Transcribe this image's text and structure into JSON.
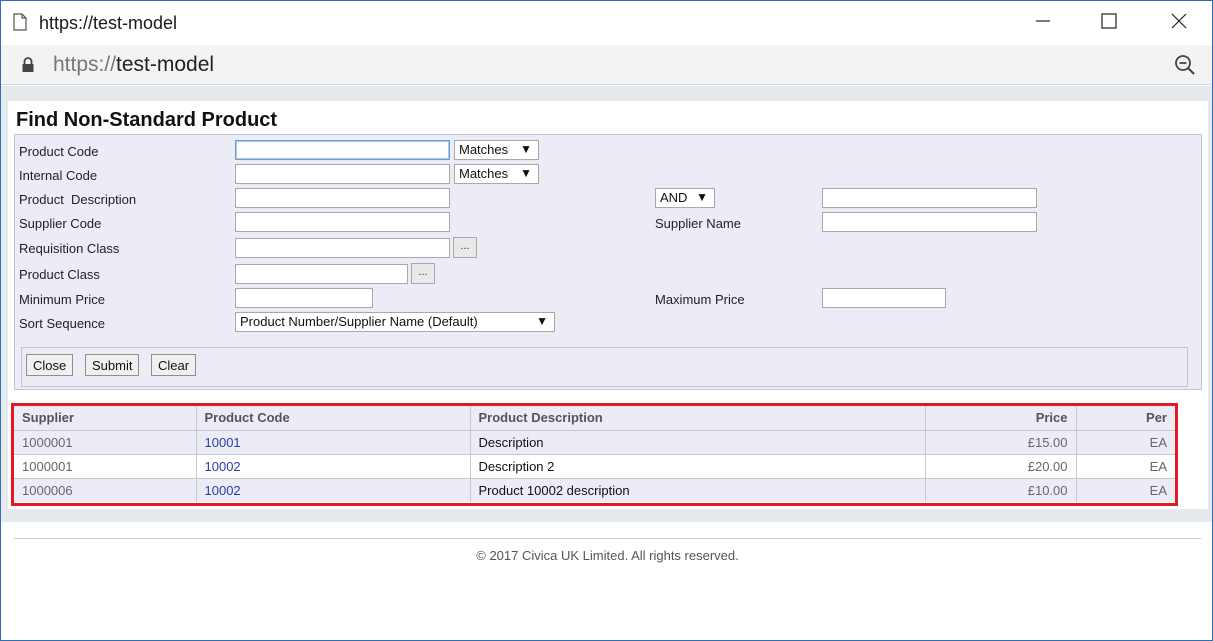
{
  "window": {
    "title": "https://test-model",
    "icons": {
      "document": "document-icon",
      "minimize": "minimize-icon",
      "maximize": "maximize-icon",
      "close": "close-icon"
    }
  },
  "address_bar": {
    "scheme": "https://",
    "host": "test-model",
    "icons": {
      "lock": "lock-icon",
      "zoom": "zoom-out-icon"
    }
  },
  "page": {
    "title": "Find Non-Standard Product"
  },
  "form": {
    "product_code_label": "Product Code",
    "product_code_value": "",
    "product_code_match": "Matches",
    "internal_code_label": "Internal Code",
    "internal_code_value": "",
    "internal_code_match": "Matches",
    "product_description_label": "Product  Description",
    "product_description_value": "",
    "description_operator": "AND",
    "description_value_2": "",
    "supplier_code_label": "Supplier Code",
    "supplier_code_value": "",
    "supplier_name_label": "Supplier Name",
    "supplier_name_value": "",
    "requisition_class_label": "Requisition Class",
    "requisition_class_value": "",
    "product_class_label": "Product Class",
    "product_class_value": "",
    "lookup_label": "...",
    "minimum_price_label": "Minimum Price",
    "minimum_price_value": "",
    "maximum_price_label": "Maximum Price",
    "maximum_price_value": "",
    "sort_sequence_label": "Sort Sequence",
    "sort_sequence_value": "Product Number/Supplier Name (Default)",
    "dropdown_arrow": "▼"
  },
  "buttons": {
    "close": "Close",
    "submit": "Submit",
    "clear": "Clear"
  },
  "results": {
    "headers": [
      "Supplier",
      "Product Code",
      "Product Description",
      "Price",
      "Per"
    ],
    "rows": [
      [
        "1000001",
        "10001",
        "Description",
        "£15.00",
        "EA"
      ],
      [
        "1000001",
        "10002",
        "Description 2",
        "£20.00",
        "EA"
      ],
      [
        "1000006",
        "10002",
        "Product 10002 description",
        "£10.00",
        "EA"
      ]
    ],
    "highlight_color": "#e01b24"
  },
  "footer": {
    "copyright": "© 2017 Civica UK Limited. All rights reserved."
  }
}
